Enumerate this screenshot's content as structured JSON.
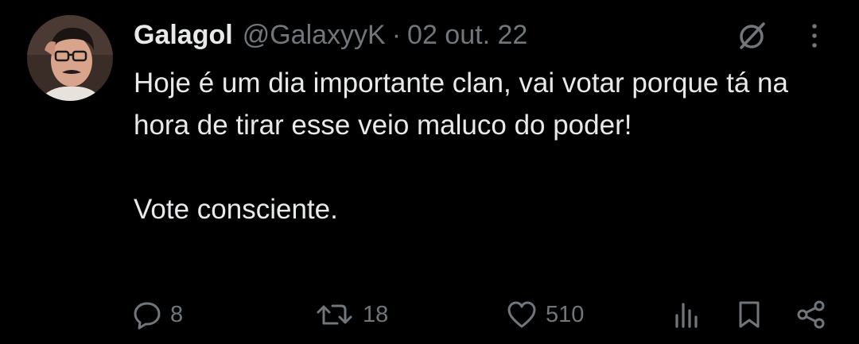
{
  "author": {
    "display_name": "Galagol",
    "handle": "@GalaxyyK",
    "separator": "·",
    "date": "02 out. 22"
  },
  "tweet": {
    "paragraphs": [
      "Hoje é um dia importante clan, vai votar porque tá na hora de tirar esse veio maluco do poder!",
      "Vote consciente."
    ]
  },
  "actions": {
    "replies": "8",
    "retweets": "18",
    "likes": "510"
  },
  "icons": {
    "grok": "grok-icon",
    "more": "more-vertical-icon",
    "reply": "reply-icon",
    "retweet": "retweet-icon",
    "like": "heart-icon",
    "views": "views-chart-icon",
    "bookmark": "bookmark-icon",
    "share": "share-icon"
  },
  "colors": {
    "background": "#000000",
    "primary_text": "#e7e9ea",
    "secondary_text": "#71767b"
  }
}
